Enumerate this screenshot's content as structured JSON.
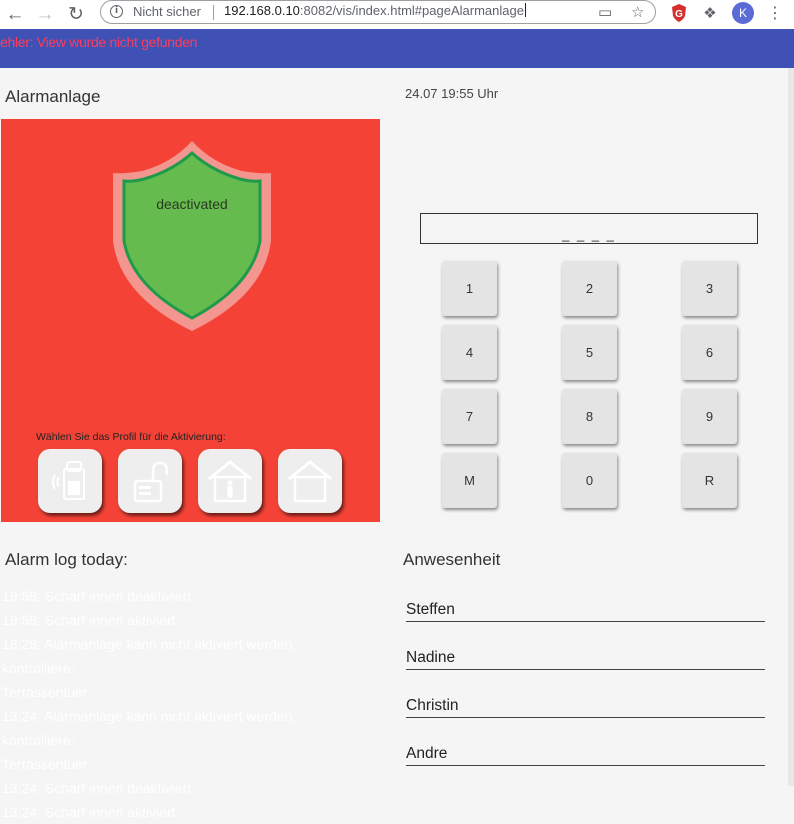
{
  "browser": {
    "security_label": "Nicht sicher",
    "url_host": "192.168.0.10",
    "url_rest": ":8082/vis/index.html#pageAlarmanlage",
    "profile_initial": "K"
  },
  "header": {
    "error_message": "ehler: View wurde nicht gefunden"
  },
  "alarm_panel": {
    "title": "Alarmanlage",
    "status": "deactivated",
    "profile_prompt": "Wählen Sie das Profil für die Aktivierung:",
    "profiles": [
      {
        "icon": "rfid-card-icon"
      },
      {
        "icon": "padlock-open-icon"
      },
      {
        "icon": "house-person-icon"
      },
      {
        "icon": "house-empty-icon"
      }
    ],
    "colors": {
      "panel": "#f44336",
      "shield": "#66bb4f",
      "shield_border": "#1e9a4a"
    }
  },
  "keypad": {
    "datetime": "24.07 19:55 Uhr",
    "display": "_ _ _ _",
    "keys": [
      "1",
      "2",
      "3",
      "4",
      "5",
      "6",
      "7",
      "8",
      "9",
      "M",
      "0",
      "R"
    ]
  },
  "alarm_log": {
    "title": "Alarm log today:",
    "entries": [
      "19:58: Scharf innen deaktiviert",
      "19:58: Scharf innen aktiviert",
      "18:28: Alarmanlage kann nicht aktiviert werden, kontrolliere:",
      "Terrassentuer",
      "13:24: Alarmanlage kann nicht aktiviert werden, kontrolliere:",
      "Terrassentuer",
      "13:24: Scharf innen deaktiviert",
      "13:24: Scharf innen aktiviert"
    ]
  },
  "presence": {
    "title": "Anwesenheit",
    "people": [
      "Steffen",
      "Nadine",
      "Christin",
      "Andre"
    ]
  }
}
